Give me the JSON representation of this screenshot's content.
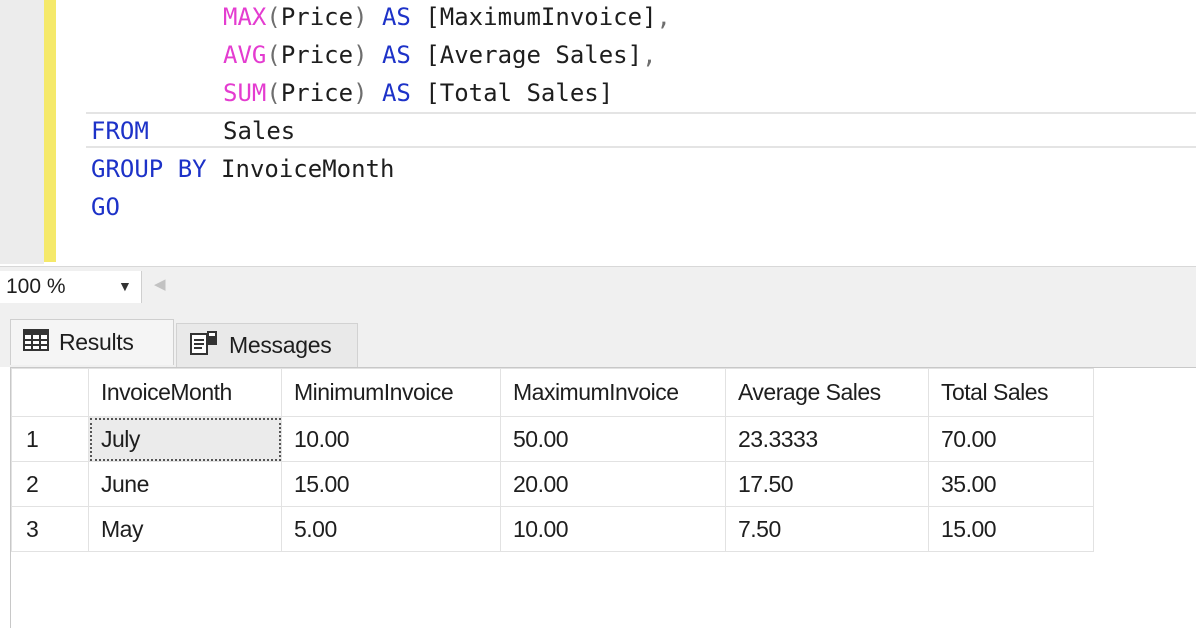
{
  "editor": {
    "lines": [
      {
        "indent": true,
        "fn": "MAX",
        "arg": "Price",
        "as": "AS",
        "alias": "[MaximumInvoice]",
        "tail": ","
      },
      {
        "indent": true,
        "fn": "AVG",
        "arg": "Price",
        "as": "AS",
        "alias": "[Average Sales]",
        "tail": ","
      },
      {
        "indent": true,
        "fn": "SUM",
        "arg": "Price",
        "as": "AS",
        "alias": "[Total Sales]",
        "tail": ""
      }
    ],
    "from_kw": "FROM",
    "from_table": "Sales",
    "group_kw": "GROUP BY",
    "group_col": "InvoiceMonth",
    "go_kw": "GO"
  },
  "zoom": {
    "value": "100 %"
  },
  "tabs": [
    {
      "label": "Results",
      "icon": "grid-icon"
    },
    {
      "label": "Messages",
      "icon": "messages-icon"
    }
  ],
  "grid": {
    "columns": [
      "",
      "InvoiceMonth",
      "MinimumInvoice",
      "MaximumInvoice",
      "Average Sales",
      "Total Sales"
    ],
    "rows": [
      [
        "1",
        "July",
        "10.00",
        "50.00",
        "23.3333",
        "70.00"
      ],
      [
        "2",
        "June",
        "15.00",
        "20.00",
        "17.50",
        "35.00"
      ],
      [
        "3",
        "May",
        "5.00",
        "10.00",
        "7.50",
        "15.00"
      ]
    ]
  },
  "colors": {
    "keyword": "#1d32c8",
    "function": "#e43cd0",
    "change_bar": "#f5e96a"
  }
}
